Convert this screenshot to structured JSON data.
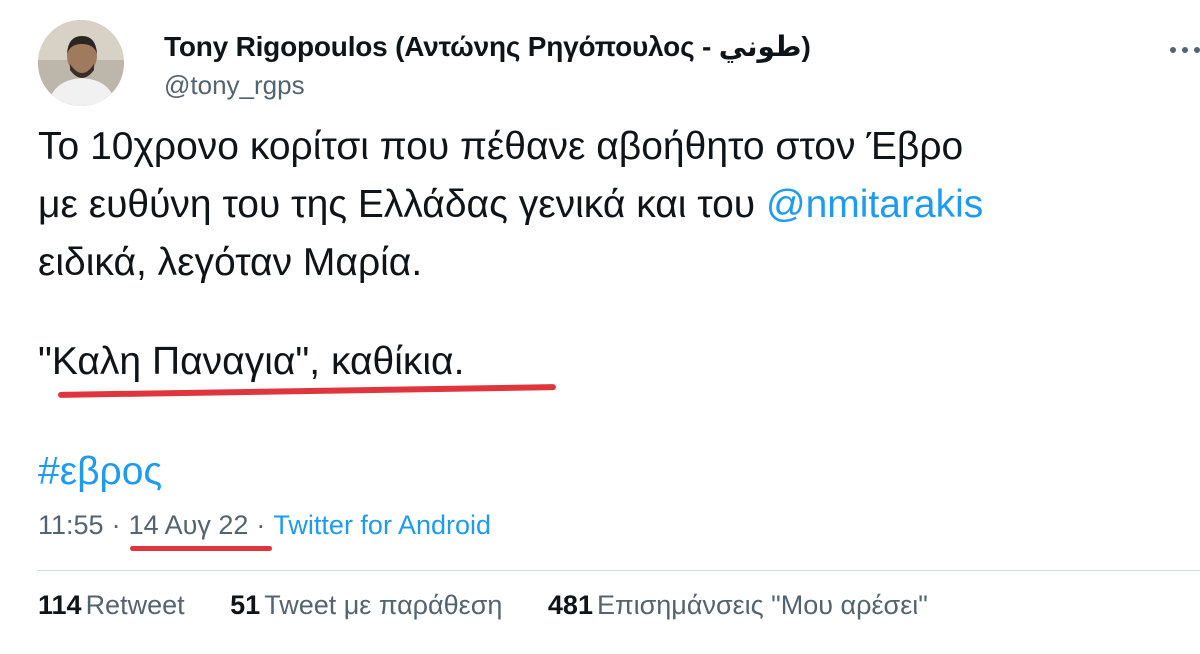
{
  "header": {
    "name": "Tony Rigopoulos (Αντώνης Ρηγόπουλος - طوني)",
    "handle": "@tony_rgps",
    "more_icon": "more-horizontal-icon"
  },
  "tweet": {
    "line1": "Το 10χρονο κορίτσι που πέθανε αβοήθητο στον Έβρο",
    "line2_prefix": "με ευθύνη του της Ελλάδας γενικά και του ",
    "line2_mention": "@nmitarakis",
    "line3": "ειδικά, λεγόταν Μαρία.",
    "quote": "\"Καλη Παναγια\", καθίκια.",
    "hashtag": "#εβρος"
  },
  "meta": {
    "time": "11:55",
    "date": "14 Αυγ 22",
    "source": "Twitter for Android",
    "separator": "·"
  },
  "stats": {
    "retweets_count": "114",
    "retweets_label": "Retweet",
    "quotes_count": "51",
    "quotes_label": "Tweet με παράθεση",
    "likes_count": "481",
    "likes_label": "Επισημάνσεις \"Μου αρέσει\""
  },
  "colors": {
    "link": "#1d9bf0",
    "secondary_text": "#536471",
    "underline_annotation": "#e0353d"
  }
}
